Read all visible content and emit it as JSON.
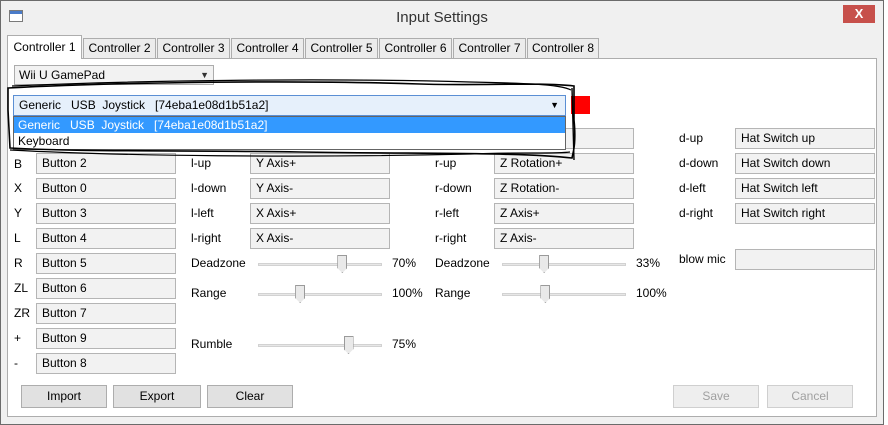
{
  "window": {
    "title": "Input Settings",
    "close_label": "X"
  },
  "tabs": [
    "Controller 1",
    "Controller 2",
    "Controller 3",
    "Controller 4",
    "Controller 5",
    "Controller 6",
    "Controller 7",
    "Controller 8"
  ],
  "controller_type": {
    "value": "Wii U GamePad"
  },
  "api": {
    "value": "Generic   USB  Joystick   [74eba1e08d1b51a2]",
    "options": [
      "Generic   USB  Joystick   [74eba1e08d1b51a2]",
      "Keyboard"
    ]
  },
  "buttons": [
    {
      "label": "B",
      "value": "Button 2"
    },
    {
      "label": "X",
      "value": "Button 0"
    },
    {
      "label": "Y",
      "value": "Button 3"
    },
    {
      "label": "L",
      "value": "Button 4"
    },
    {
      "label": "R",
      "value": "Button 5"
    },
    {
      "label": "ZL",
      "value": "Button 6"
    },
    {
      "label": "ZR",
      "value": "Button 7"
    },
    {
      "label": "+",
      "value": "Button 9"
    },
    {
      "label": "-",
      "value": "Button 8"
    }
  ],
  "left_stick": [
    {
      "label": "l-up",
      "value": "Y Axis+"
    },
    {
      "label": "l-down",
      "value": "Y Axis-"
    },
    {
      "label": "l-left",
      "value": "X Axis+"
    },
    {
      "label": "l-right",
      "value": "X Axis-"
    }
  ],
  "right_stick": [
    {
      "label": "r-up",
      "value": "Z Rotation+"
    },
    {
      "label": "r-down",
      "value": "Z Rotation-"
    },
    {
      "label": "r-left",
      "value": "Z Axis+"
    },
    {
      "label": "r-right",
      "value": "Z Axis-"
    }
  ],
  "dpad": [
    {
      "label": "d-up",
      "value": "Hat Switch up"
    },
    {
      "label": "d-down",
      "value": "Hat Switch down"
    },
    {
      "label": "d-left",
      "value": "Hat Switch left"
    },
    {
      "label": "d-right",
      "value": "Hat Switch right"
    }
  ],
  "blow_mic": {
    "label": "blow mic",
    "value": ""
  },
  "left_sliders": {
    "deadzone": {
      "label": "Deadzone",
      "value_text": "70%",
      "fraction": 0.68
    },
    "range": {
      "label": "Range",
      "value_text": "100%",
      "fraction": 0.34
    },
    "rumble": {
      "label": "Rumble",
      "value_text": "75%",
      "fraction": 0.73
    }
  },
  "right_sliders": {
    "deadzone": {
      "label": "Deadzone",
      "value_text": "33%",
      "fraction": 0.34
    },
    "range": {
      "label": "Range",
      "value_text": "100%",
      "fraction": 0.35
    }
  },
  "footer": {
    "import": "Import",
    "export": "Export",
    "clear": "Clear",
    "save": "Save",
    "cancel": "Cancel"
  },
  "colors": {
    "highlight": "#3399ff",
    "close_button": "#c7504b",
    "red_marker": "#ff0000"
  }
}
